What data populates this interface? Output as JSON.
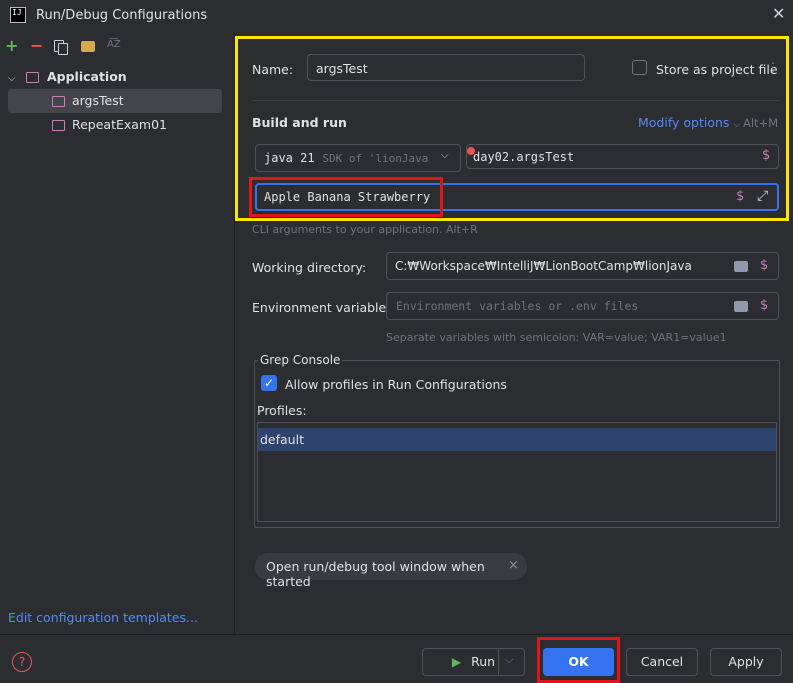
{
  "window": {
    "logo_text": "IJ",
    "title": "Run/Debug Configurations",
    "close_icon": "close-icon"
  },
  "toolbar": {
    "add": "+",
    "remove": "−",
    "sort": "A͞Z"
  },
  "tree": {
    "root_label": "Application",
    "items": [
      {
        "label": "argsTest"
      },
      {
        "label": "RepeatExam01"
      }
    ]
  },
  "left_footer": {
    "edit_templates": "Edit configuration templates..."
  },
  "form": {
    "name_label": "Name:",
    "name_value": "argsTest",
    "store_label": "Store as project file",
    "section_title": "Build and run",
    "modify_options": "Modify options",
    "modify_shortcut": "Alt+M",
    "jdk_value": "java 21",
    "jdk_hint": "SDK of 'lionJava",
    "main_class": "day02.argsTest",
    "cli_args": "Apple Banana Strawberry",
    "cli_hint": "CLI arguments to your application. Alt+R",
    "workdir_label": "Working directory:",
    "workdir_value": "C:₩Workspace₩IntelliJ₩LionBootCamp₩lionJava",
    "env_label": "Environment variables:",
    "env_placeholder": "Environment variables or .env files",
    "env_hint": "Separate variables with semicolon: VAR=value; VAR1=value1",
    "grep_title": "Grep Console",
    "allow_profiles": "Allow profiles in Run Configurations",
    "profiles_label": "Profiles:",
    "profiles": [
      "default"
    ],
    "chip_label": "Open run/debug tool window when started",
    "chip_close": "×"
  },
  "buttons": {
    "help": "?",
    "run": "Run",
    "ok": "OK",
    "cancel": "Cancel",
    "apply": "Apply"
  },
  "colors": {
    "accent": "#3574f0",
    "highlight_yellow": "#ffe600",
    "highlight_red": "#e4141c",
    "config_icon": "#c77dbb"
  }
}
